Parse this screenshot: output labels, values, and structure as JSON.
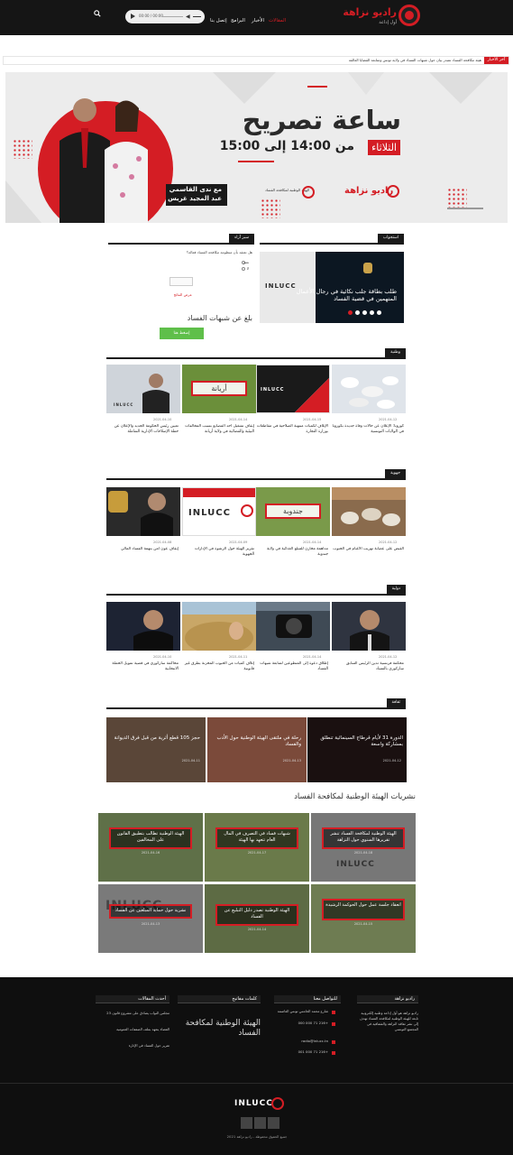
{
  "header": {
    "logo_title": "راديو نزاهة",
    "logo_sub": "أول إذاعة",
    "nav": [
      "المقالات",
      "الأخبار",
      "البرامج",
      "إتصل بنا"
    ],
    "player_time": "00:00 / 00:00"
  },
  "ticker": {
    "label": "آخر الأخبار",
    "text": "هيئة مكافحة الفساد تصدر بيان حول شبهات الفساد في ولاية تونس ومتابعة القضايا العالقة"
  },
  "banner": {
    "title": "ساعة تصريح",
    "day": "الثلاثاء",
    "time": "من 14:00 إلى 15:00",
    "host_line1": "مع ندى القاسمي",
    "host_line2": "عبد المجيد غريس",
    "logo_text": "راديو نزاهة",
    "agency_text": "الهيئة الوطنية لمكافحة الفساد"
  },
  "sections": {
    "istijwab": "استجواب",
    "sabr": "سبر آراء",
    "wataniya": "وطنية",
    "jihawiya": "جهوية",
    "dawliya": "دولية",
    "thaqafa": "ثقافة",
    "publications": "نشريات الهيئة الوطنية لمكافحة الفساد"
  },
  "slider": {
    "text": "طلب بطاقة جلب نكائية في رجال الأعمال المتهمين في قضية الفساد"
  },
  "poll": {
    "question": "هل تعتقد بأن منظومة مكافحة الفساد فعالة؟",
    "opt_yes": "نعم",
    "opt_no": "لا",
    "result_link": "عرض النتائج",
    "report_title": "بلغ عن شبهات الفساد",
    "report_button": "إضغط هنا"
  },
  "wataniya_cards": [
    {
      "date": "2021-04-12",
      "title": "كورونا: الإعلان عن حالات وفاة جديدة بكورونا في الولايات التونسية",
      "label": ""
    },
    {
      "date": "2021-04-15",
      "title": "الإتلاف لكميات منتهية الصلاحية في مقاطعات بوزارة التجارة",
      "label": ""
    },
    {
      "date": "2021-04-14",
      "title": "إيقاف تشغيل أحد المصانع بسبب المخالفات البيئية والقضائية في ولاية أريانة",
      "label": "أريانة"
    },
    {
      "date": "2021-04-10",
      "title": "تعيين رئيس الحكومة الجديد والإعلان عن خطة الإصلاحات الإدارية الشاملة",
      "label": ""
    }
  ],
  "jihawiya_cards": [
    {
      "date": "2021-04-12",
      "title": "القبض على عصابة تهريب الأغنام في الجنوب",
      "label": ""
    },
    {
      "date": "2021-04-14",
      "title": "مداهمة مخازن للسلع الغذائية في ولاية جندوبة",
      "label": "جندوبة"
    },
    {
      "date": "2021-04-09",
      "title": "تقرير الهيئة حول الرشوة في الإدارات الجهوية",
      "label": ""
    },
    {
      "date": "2021-04-08",
      "title": "إيقاف عون أمن بتهمة الفساد المالي",
      "label": ""
    }
  ],
  "dawliya_cards": [
    {
      "date": "2021-04-12",
      "title": "محكمة فرنسية تدين الرئيس السابق ساركوزي بالفساد",
      "label": ""
    },
    {
      "date": "2021-04-14",
      "title": "إطلاق دعوة إلى المتطوعين لمتابعة شبهات الفساد",
      "label": ""
    },
    {
      "date": "2021-04-11",
      "title": "إتلاف كميات من الحبوب المخزنة بطرق غير قانونية",
      "label": ""
    },
    {
      "date": "2021-04-10",
      "title": "محاكمة ساركوزي في قضية تمويل الحملة الانتخابية",
      "label": ""
    }
  ],
  "thaqafa_cards": [
    {
      "date": "2021-04-12",
      "title": "الدورة 31 لأيام قرطاج السينمائية تنطلق بمشاركة واسعة"
    },
    {
      "date": "2021-04-13",
      "title": "رحلة في ملتقى الهيئة الوطنية حول الأدب والفساد"
    },
    {
      "date": "2021-04-11",
      "title": "حجز 105 قطع أثرية من قبل فرق الديوانة"
    }
  ],
  "publications": [
    {
      "date": "2021-04-18",
      "title": "الهيئة الوطنية لمكافحة الفساد تنشر تقريرها السنوي حول النزاهة"
    },
    {
      "date": "2021-04-17",
      "title": "شبهات فساد في التصرف في المال العام تتعهد بها الهيئة"
    },
    {
      "date": "2021-04-16",
      "title": "الهيئة الوطنية تطالب بتطبيق القانون على المخالفين"
    },
    {
      "date": "2021-04-15",
      "title": "انعقاد جلسة عمل حول الحوكمة الرشيدة"
    },
    {
      "date": "2021-04-14",
      "title": "الهيئة الوطنية تصدر دليل التبليغ عن الفساد"
    },
    {
      "date": "2021-04-13",
      "title": "نشرية حول حماية المبلغين عن الفساد"
    }
  ],
  "footer": {
    "about_title": "راديو نزاهة",
    "about_text": "راديو نزاهة هو أول إذاعة وطنية إلكترونية تابعة للهيئة الوطنية لمكافحة الفساد تهدف إلى نشر ثقافة النزاهة والشفافية في المجتمع التونسي",
    "contact_title": "للتواصل معنا",
    "contact_address": "شارع محمد الخامس تونس العاصمة",
    "contact_phone": "+216 71 000 000",
    "contact_email": "radio@inlucc.tn",
    "contact_fax": "+216 71 000 001",
    "tags_title": "كلمات مفاتيح",
    "tags_text": "الهيئة الوطنية لمكافحة الفساد",
    "latest_title": "أحدث المقالات",
    "latest_items": [
      "مجلس النواب يصادق على مشروع قانون 23",
      "القضاء يتعهد بملف الصفقات العمومية",
      "تقرير حول الفساد في الإدارة"
    ],
    "brand": "INLUCC",
    "copyright": "جميع الحقوق محفوظة - راديو نزاهة 2021"
  },
  "colors": {
    "accent": "#d41d24",
    "dark": "#151515"
  }
}
